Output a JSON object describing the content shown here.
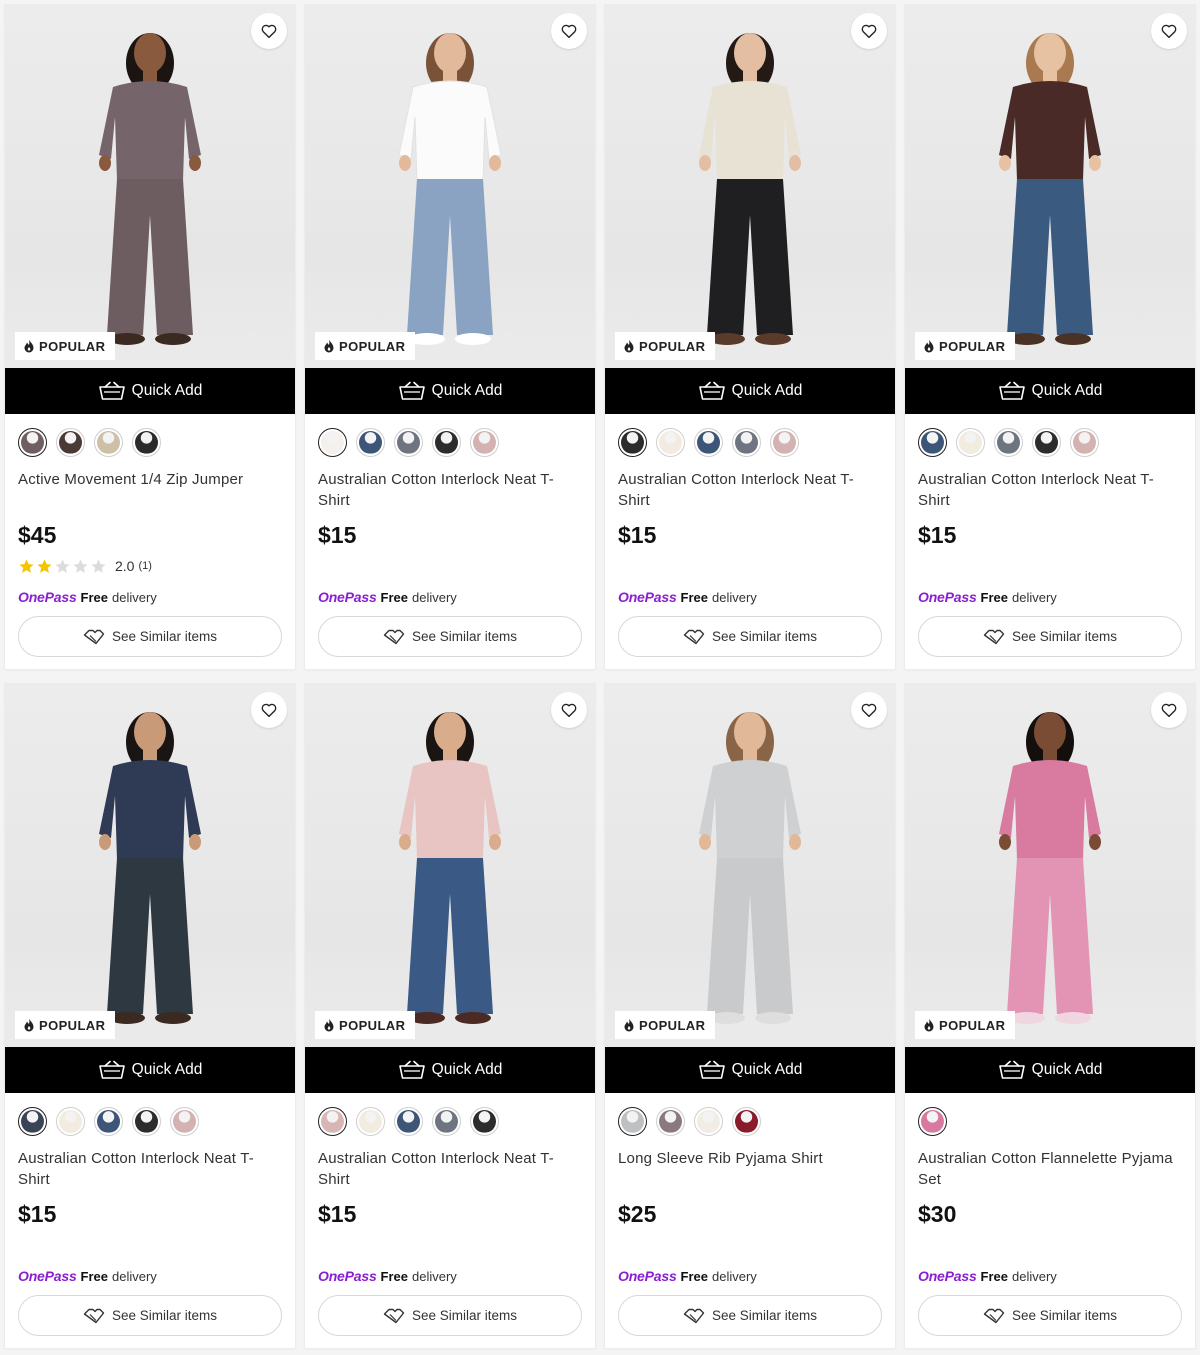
{
  "common": {
    "quick_add_label": "Quick Add",
    "popular_label": "POPULAR",
    "onepass_label": "OnePass",
    "free_label": "Free",
    "delivery_label": "delivery",
    "see_similar_label": "See Similar items",
    "icons": {
      "wishlist": "heart-icon",
      "popular": "flame-icon",
      "quick_add": "basket-icon",
      "similar": "similar-tag-icon"
    },
    "colors": {
      "onepass": "#8b1fd0",
      "star": "#f5c400",
      "quick_add_bg": "#000000"
    }
  },
  "products": [
    {
      "title": "Active Movement 1/4 Zip Jumper",
      "price": "$45",
      "rating": {
        "value": "2.0",
        "count": "(1)",
        "stars": 2
      },
      "swatches": [
        "#6f5f60",
        "#4a3a34",
        "#cdbfa8",
        "#2b2b2b"
      ],
      "model": {
        "skin": "#8a5a3f",
        "hair": "#1b1410",
        "top": "#75656a",
        "bottom": "#6d5d61",
        "shoes": "#3a2a22"
      }
    },
    {
      "title": "Australian Cotton Interlock Neat T-Shirt",
      "price": "$15",
      "swatches": [
        "#f4f1ec",
        "#3d5577",
        "#6e7480",
        "#2c2c2c",
        "#d4b2b2"
      ],
      "model": {
        "skin": "#e3b99c",
        "hair": "#7a5238",
        "top": "#fbfbfb",
        "bottom": "#8aa3c2",
        "shoes": "#ffffff"
      }
    },
    {
      "title": "Australian Cotton Interlock Neat T-Shirt",
      "price": "$15",
      "swatches": [
        "#2c2c2c",
        "#f2ebe0",
        "#3d5577",
        "#6e7480",
        "#d4b2b2"
      ],
      "model": {
        "skin": "#e4bea2",
        "hair": "#231a16",
        "top": "#e8e2d4",
        "bottom": "#1f1f22",
        "shoes": "#5a3a2a"
      }
    },
    {
      "title": "Australian Cotton Interlock Neat T-Shirt",
      "price": "$15",
      "swatches": [
        "#3d5577",
        "#f2ebe0",
        "#6e7480",
        "#2c2c2c",
        "#d4b2b2"
      ],
      "model": {
        "skin": "#e6c2a3",
        "hair": "#a9794f",
        "top": "#4a2a26",
        "bottom": "#3b5a80",
        "shoes": "#4a3325"
      }
    },
    {
      "title": "Australian Cotton Interlock Neat T-Shirt",
      "price": "$15",
      "swatches": [
        "#3b4454",
        "#f2ebe0",
        "#3d5577",
        "#2c2c2c",
        "#d4b2b2"
      ],
      "model": {
        "skin": "#c99a78",
        "hair": "#1a1412",
        "top": "#2f3a55",
        "bottom": "#2d3840",
        "shoes": "#3a2a22"
      }
    },
    {
      "title": "Australian Cotton Interlock Neat T-Shirt",
      "price": "$15",
      "swatches": [
        "#d9b6b6",
        "#f2ebe0",
        "#3d5577",
        "#6e7480",
        "#2c2c2c"
      ],
      "model": {
        "skin": "#d9ad8c",
        "hair": "#1a1412",
        "top": "#e8c4c2",
        "bottom": "#3a5a85",
        "shoes": "#4a2a22"
      }
    },
    {
      "title": "Long Sleeve Rib Pyjama Shirt",
      "price": "$25",
      "swatches": [
        "#bfc0c2",
        "#8a7a80",
        "#f1ece6",
        "#8a1b2a"
      ],
      "model": {
        "skin": "#e1b898",
        "hair": "#8a6446",
        "top": "#cfd0d2",
        "bottom": "#c9cacc",
        "shoes": "#dedede"
      }
    },
    {
      "title": "Australian Cotton Flannelette Pyjama Set",
      "price": "$30",
      "swatches": [
        "#d87aa0"
      ],
      "model": {
        "skin": "#7a4c34",
        "hair": "#140e0c",
        "top": "#d97aa0",
        "bottom": "#e394b4",
        "shoes": "#f0d6e0"
      }
    }
  ]
}
